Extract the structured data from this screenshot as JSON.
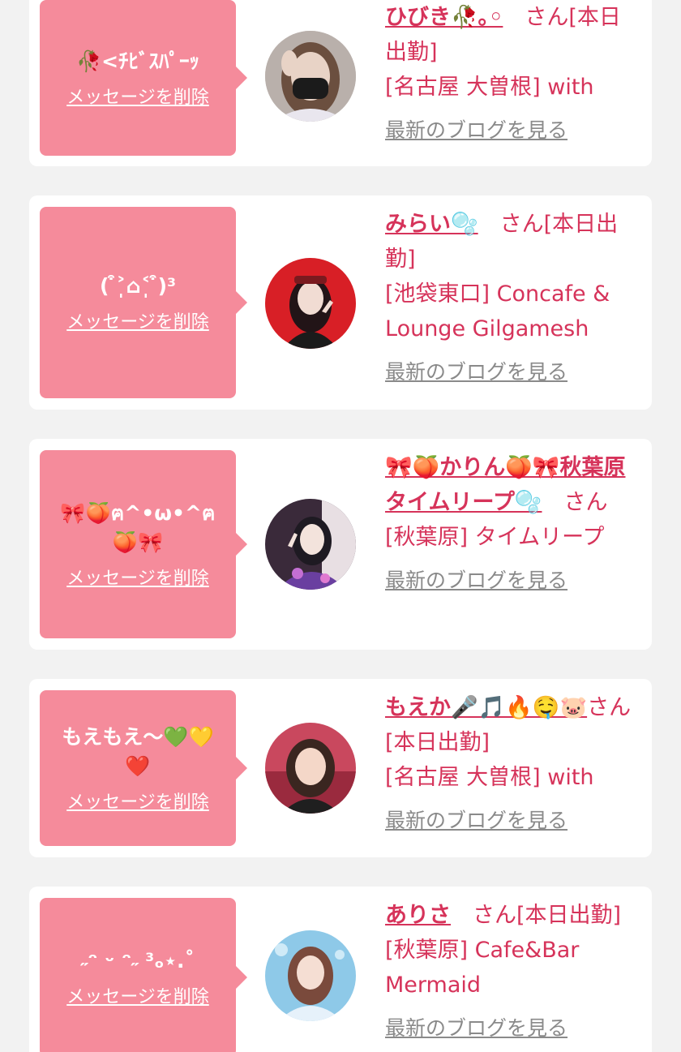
{
  "accent_color": "#d6335a",
  "bubble_color": "#f58b9b",
  "delete_label": "メッセージを削除",
  "blog_label": "最新のブログを見る",
  "entries": [
    {
      "bubble_text": "🥀<ﾁﾋﾞｽﾊﾟｰｯ",
      "name": "ひびき🥀｡◦",
      "suffix": "　さん[本日出勤]",
      "shop": "[名古屋 大曽根] with",
      "avatar_icon": "woman-with-black-mask-icon"
    },
    {
      "bubble_text": "( ͒˃̩̩⌂˂̩̩ ͒)³",
      "name": "みらい🫧",
      "suffix": "　さん[本日出勤]",
      "shop": "[池袋東口] Concafe & Lounge Gilgamesh",
      "avatar_icon": "woman-red-background-icon"
    },
    {
      "bubble_text": "🎀🍑ฅ^•ω•^ฅ🍑🎀",
      "name": "🎀🍑かりん🍑🎀秋葉原タイムリープ🫧",
      "suffix": "　さん",
      "shop": "[秋葉原] タイムリープ",
      "avatar_icon": "woman-purple-kimono-icon"
    },
    {
      "bubble_text": "もえもえ〜💚💛❤️",
      "name": "もえか🎤🎵🔥🤤🐷",
      "suffix": "さん[本日出勤]",
      "shop": "[名古屋 大曽根] with",
      "avatar_icon": "woman-pink-room-icon"
    },
    {
      "bubble_text": "˶ᵔ ᵕ ᵔ˶ ³ₒ⋆.˚",
      "name": "ありさ",
      "suffix": "　さん[本日出勤]",
      "shop": "[秋葉原] Cafe&Bar Mermaid",
      "avatar_icon": "woman-blue-background-icon"
    }
  ]
}
